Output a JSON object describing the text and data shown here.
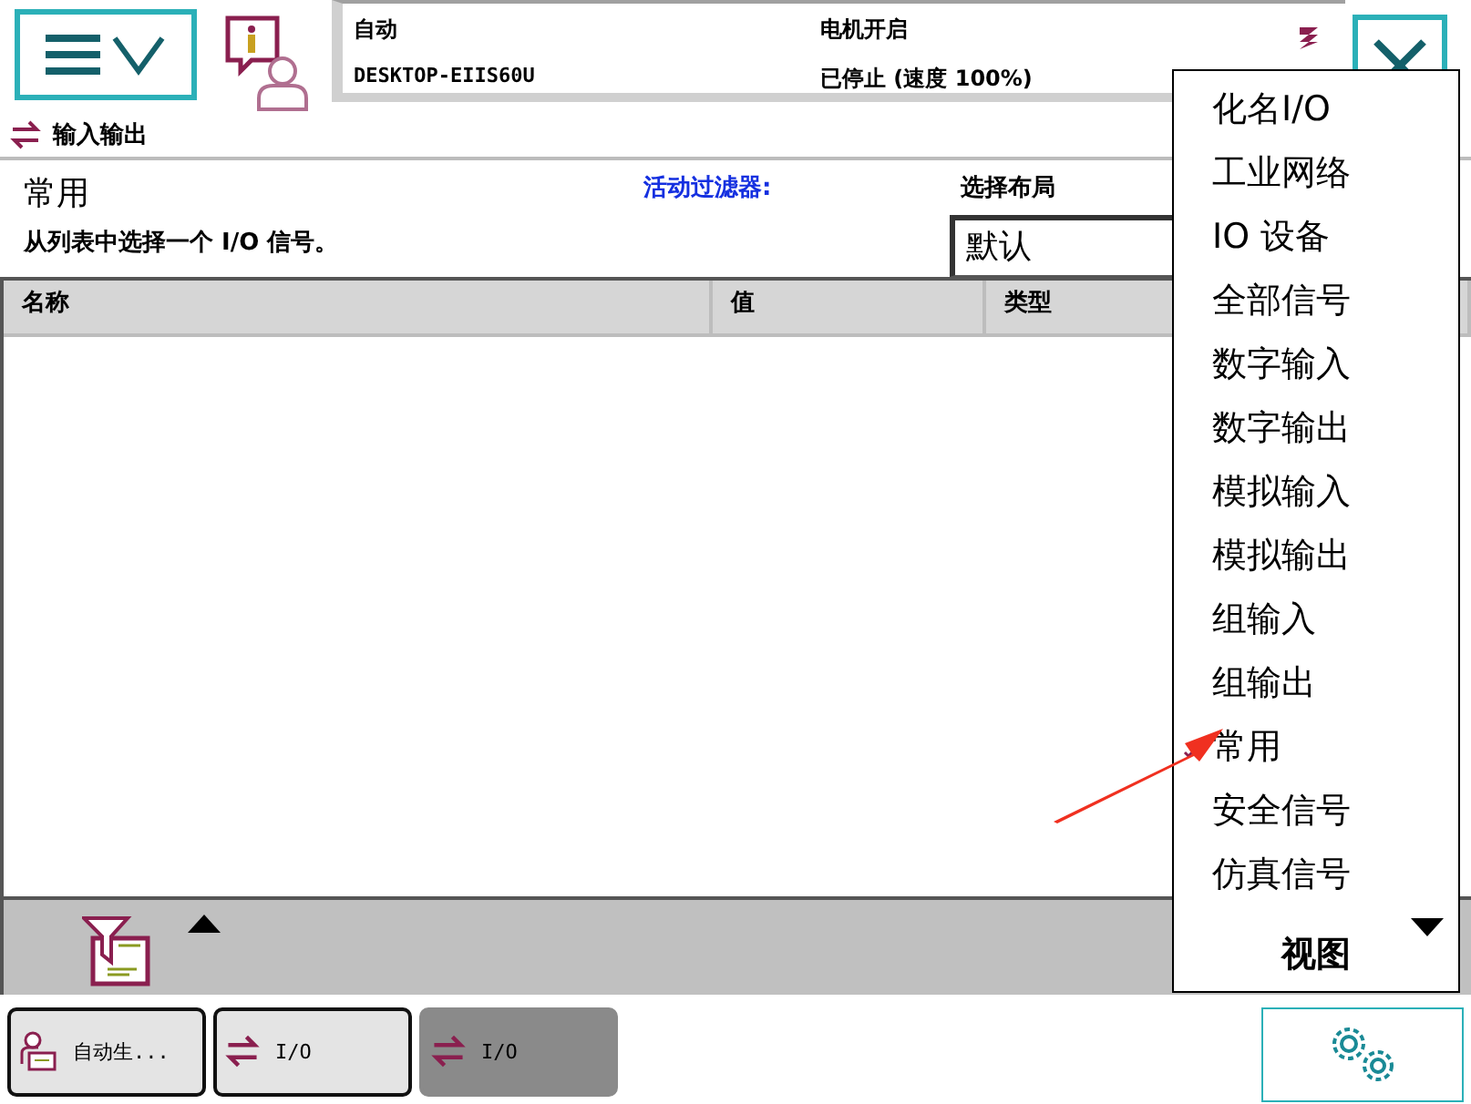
{
  "status": {
    "mode": "自动",
    "system": "DESKTOP-EIIS60U",
    "motors": "电机开启",
    "state": "已停止 (速度 100%)"
  },
  "app_title": "输入输出",
  "view": {
    "title": "常用",
    "instruction": "从列表中选择一个 I/O 信号。",
    "filter_label": "活动过滤器:",
    "layout_label": "选择布局",
    "layout_value": "默认"
  },
  "table": {
    "columns": [
      "名称",
      "值",
      "类型"
    ]
  },
  "menu": {
    "items": [
      {
        "label": "化名I/O",
        "selected": false
      },
      {
        "label": "工业网络",
        "selected": false
      },
      {
        "label": "IO 设备",
        "selected": false
      },
      {
        "label": "全部信号",
        "selected": false
      },
      {
        "label": "数字输入",
        "selected": false
      },
      {
        "label": "数字输出",
        "selected": false
      },
      {
        "label": "模拟输入",
        "selected": false
      },
      {
        "label": "模拟输出",
        "selected": false
      },
      {
        "label": "组输入",
        "selected": false
      },
      {
        "label": "组输出",
        "selected": false
      },
      {
        "label": "常用",
        "selected": true
      },
      {
        "label": "安全信号",
        "selected": false
      },
      {
        "label": "仿真信号",
        "selected": false
      }
    ],
    "footer": "视图"
  },
  "taskbar": [
    {
      "label": "自动生...",
      "kind": "operator",
      "selected": false
    },
    {
      "label": "I/O",
      "kind": "io",
      "selected": false
    },
    {
      "label": "I/O",
      "kind": "io",
      "selected": true
    }
  ]
}
